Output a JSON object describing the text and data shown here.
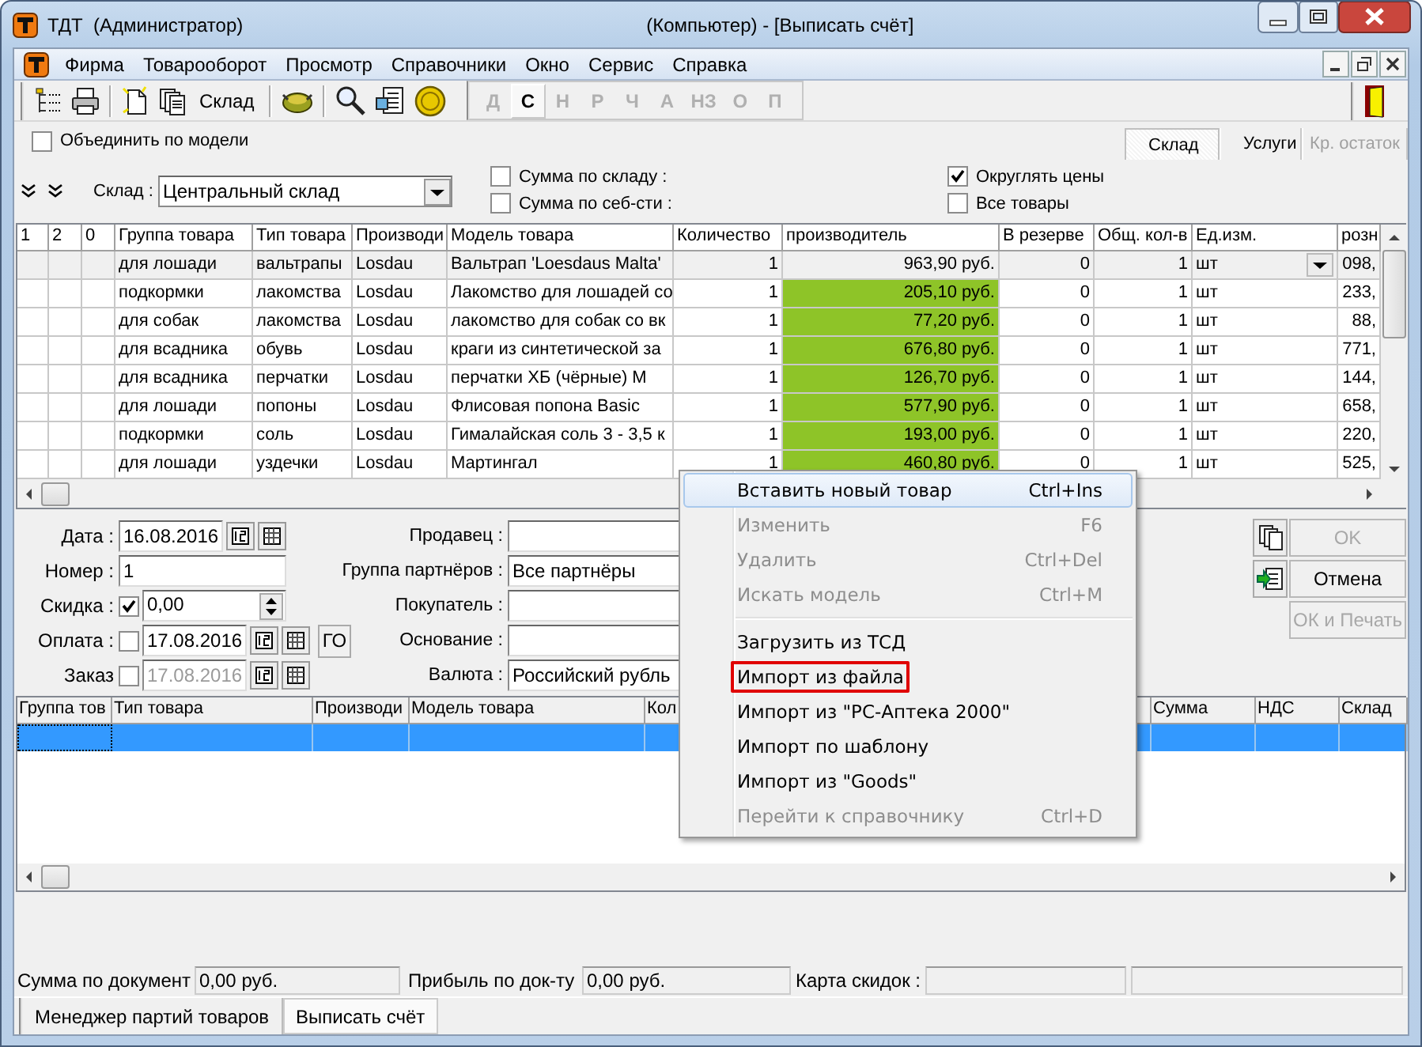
{
  "window": {
    "title": "ТДТ  (Администратор)",
    "subtitle": "(Компьютер) - [Выписать счёт]"
  },
  "menu_bar": [
    "Фирма",
    "Товарооборот",
    "Просмотр",
    "Справочники",
    "Окно",
    "Сервис",
    "Справка"
  ],
  "toolbar": {
    "warehouse_button": "Склад",
    "letters": [
      {
        "label": "Д",
        "selected": false
      },
      {
        "label": "С",
        "selected": true
      },
      {
        "label": "Н",
        "selected": false
      },
      {
        "label": "Р",
        "selected": false
      },
      {
        "label": "Ч",
        "selected": false
      },
      {
        "label": "А",
        "selected": false
      },
      {
        "label": "НЗ",
        "selected": false
      },
      {
        "label": "О",
        "selected": false
      },
      {
        "label": "П",
        "selected": false
      }
    ]
  },
  "merge_by_model": {
    "label": "Объединить по модели",
    "checked": false
  },
  "view_tabs": [
    {
      "label": "Склад",
      "selected": true,
      "disabled": false
    },
    {
      "label": "Услуги",
      "selected": false,
      "disabled": false
    },
    {
      "label": "Кр. остаток",
      "selected": false,
      "disabled": true
    }
  ],
  "filters": {
    "warehouse_label": "Склад :",
    "warehouse": "Центральный склад",
    "options": [
      {
        "label": "Сумма по складу :",
        "checked": false
      },
      {
        "label": "Сумма по себ-сти :",
        "checked": false
      },
      {
        "label": "Округлять цены",
        "checked": true
      },
      {
        "label": "Все товары",
        "checked": false
      }
    ]
  },
  "stock_table": {
    "columns": [
      "1",
      "2",
      "0",
      "Группа товара",
      "Тип товара",
      "Производи",
      "Модель товара",
      "Количество",
      "производитель",
      "В резерве",
      "Общ. кол-в",
      "Ед.изм.",
      "розн"
    ],
    "rows": [
      {
        "selected": true,
        "cells": [
          "",
          "",
          "",
          "для лошади",
          "вальтрапы",
          "Losdau",
          "Вальтрап 'Loesdaus Malta'",
          "1",
          "963,90 руб.",
          "0",
          "1",
          "шт",
          "098,"
        ]
      },
      {
        "selected": false,
        "cells": [
          "",
          "",
          "",
          "подкормки",
          "лакомства",
          "Losdau",
          "Лакомство для лошадей со",
          "1",
          "205,10 руб.",
          "0",
          "1",
          "шт",
          "233,"
        ]
      },
      {
        "selected": false,
        "cells": [
          "",
          "",
          "",
          "для собак",
          "лакомства",
          "Losdau",
          "лакомство для собак со вк",
          "1",
          "77,20 руб.",
          "0",
          "1",
          "шт",
          "88,"
        ]
      },
      {
        "selected": false,
        "cells": [
          "",
          "",
          "",
          "для всадника",
          "обувь",
          "Losdau",
          "краги из синтетической за",
          "1",
          "676,80 руб.",
          "0",
          "1",
          "шт",
          "771,"
        ]
      },
      {
        "selected": false,
        "cells": [
          "",
          "",
          "",
          "для всадника",
          "перчатки",
          "Losdau",
          "перчатки ХБ (чёрные) М",
          "1",
          "126,70 руб.",
          "0",
          "1",
          "шт",
          "144,"
        ]
      },
      {
        "selected": false,
        "cells": [
          "",
          "",
          "",
          "для лошади",
          "попоны",
          "Losdau",
          "Флисовая попона Basic",
          "1",
          "577,90 руб.",
          "0",
          "1",
          "шт",
          "658,"
        ]
      },
      {
        "selected": false,
        "cells": [
          "",
          "",
          "",
          "подкормки",
          "соль",
          "Losdau",
          "Гималайская соль 3 - 3,5 к",
          "1",
          "193,00 руб.",
          "0",
          "1",
          "шт",
          "220,"
        ]
      },
      {
        "selected": false,
        "cells": [
          "",
          "",
          "",
          "для лошади",
          "уздечки",
          "Losdau",
          "Мартингал",
          "1",
          "460,80 руб.",
          "0",
          "1",
          "шт",
          "525,"
        ]
      }
    ]
  },
  "document": {
    "date_label": "Дата :",
    "date": "16.08.2016",
    "number_label": "Номер :",
    "number": "1",
    "discount": {
      "label": "Скидка :",
      "checked": true,
      "value": "0,00"
    },
    "payment": {
      "label": "Оплата :",
      "checked": false,
      "date": "17.08.2016",
      "disabled": false
    },
    "go_button": "ГО",
    "order": {
      "label": "Заказ",
      "checked": false,
      "date": "17.08.2016",
      "disabled": true
    }
  },
  "parties": [
    {
      "label": "Продавец :"
    },
    {
      "label": "Группа партнёров :",
      "value": "Все партнёры"
    },
    {
      "label": "Покупатель :"
    },
    {
      "label": "Основание :"
    },
    {
      "label": "Валюта :",
      "value": "Российский рубль"
    }
  ],
  "actions": [
    {
      "label": "OK",
      "disabled": true
    },
    {
      "label": "Отмена",
      "disabled": false
    },
    {
      "label": "ОК и Печать",
      "disabled": true
    }
  ],
  "items_table": {
    "columns": [
      "Группа тов",
      "Тип товара",
      "Производи",
      "Модель товара",
      "Кол",
      "Сумма",
      "НДС",
      "Склад"
    ]
  },
  "totals": [
    {
      "label": "Сумма по документ",
      "value": "0,00 руб."
    },
    {
      "label": "Прибыль по док-ту",
      "value": "0,00 руб."
    },
    {
      "label": "Карта скидок :"
    }
  ],
  "bottom_tabs": [
    {
      "label": "Менеджер партий товаров",
      "selected": false
    },
    {
      "label": "Выписать счёт",
      "selected": true
    }
  ],
  "context_menu": [
    {
      "kind": "item",
      "label": "Вставить новый товар",
      "shortcut": "Ctrl+Ins",
      "disabled": false,
      "selected": true,
      "marked": false
    },
    {
      "kind": "item",
      "label": "Изменить",
      "shortcut": "F6",
      "disabled": true,
      "selected": false,
      "marked": false
    },
    {
      "kind": "item",
      "label": "Удалить",
      "shortcut": "Ctrl+Del",
      "disabled": true,
      "selected": false,
      "marked": false
    },
    {
      "kind": "item",
      "label": "Искать модель",
      "shortcut": "Ctrl+M",
      "disabled": true,
      "selected": false,
      "marked": false
    },
    {
      "kind": "separator"
    },
    {
      "kind": "item",
      "label": "Загрузить из ТСД",
      "disabled": false,
      "selected": false,
      "marked": false
    },
    {
      "kind": "item",
      "label": "Импорт из файла",
      "disabled": false,
      "selected": false,
      "marked": true
    },
    {
      "kind": "item",
      "label": "Импорт из \"PC-Аптека 2000\"",
      "disabled": false,
      "selected": false,
      "marked": false
    },
    {
      "kind": "item",
      "label": "Импорт по шаблону",
      "disabled": false,
      "selected": false,
      "marked": false
    },
    {
      "kind": "item",
      "label": "Импорт из \"Goods\"",
      "disabled": false,
      "selected": false,
      "marked": false
    },
    {
      "kind": "item",
      "label": "Перейти к справочнику",
      "shortcut": "Ctrl+D",
      "disabled": true,
      "selected": false,
      "marked": false
    }
  ]
}
